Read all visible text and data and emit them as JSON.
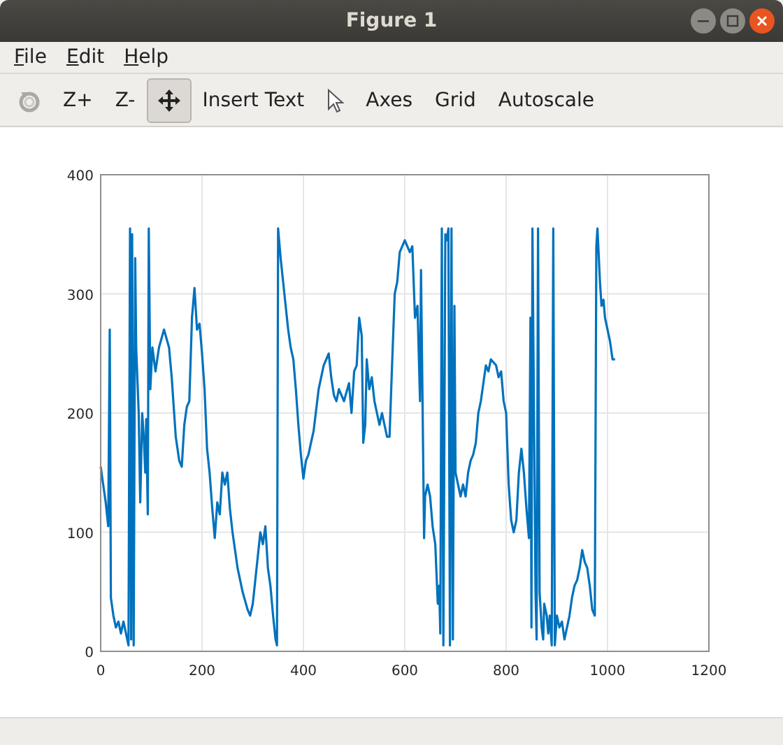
{
  "window": {
    "title": "Figure 1"
  },
  "menu": [
    {
      "label": "File"
    },
    {
      "label": "Edit"
    },
    {
      "label": "Help"
    }
  ],
  "toolbar": [
    {
      "kind": "rotate",
      "selected": false
    },
    {
      "kind": "text",
      "label": "Z+",
      "selected": false
    },
    {
      "kind": "text",
      "label": "Z-",
      "selected": false
    },
    {
      "kind": "pan",
      "selected": true
    },
    {
      "kind": "text",
      "label": "Insert Text",
      "selected": false
    },
    {
      "kind": "pointer",
      "selected": false
    },
    {
      "kind": "text",
      "label": "Axes",
      "selected": false
    },
    {
      "kind": "text",
      "label": "Grid",
      "selected": false
    },
    {
      "kind": "text",
      "label": "Autoscale",
      "selected": false
    }
  ],
  "plot": {
    "chart_data": {
      "type": "line",
      "grid": true,
      "xlim": [
        0,
        1200
      ],
      "ylim": [
        0,
        400
      ],
      "xticks": [
        0,
        200,
        400,
        600,
        800,
        1000,
        1200
      ],
      "yticks": [
        0,
        100,
        200,
        300,
        400
      ],
      "x": [
        0,
        5,
        10,
        15,
        18,
        20,
        25,
        30,
        35,
        40,
        45,
        50,
        55,
        58,
        60,
        62,
        65,
        68,
        70,
        75,
        78,
        82,
        85,
        88,
        90,
        93,
        95,
        98,
        102,
        108,
        115,
        125,
        135,
        140,
        148,
        155,
        160,
        165,
        170,
        175,
        180,
        185,
        190,
        195,
        200,
        205,
        210,
        215,
        220,
        225,
        230,
        235,
        240,
        245,
        250,
        255,
        260,
        265,
        270,
        280,
        290,
        295,
        300,
        305,
        310,
        315,
        320,
        325,
        330,
        335,
        340,
        345,
        348,
        350,
        355,
        360,
        365,
        370,
        375,
        380,
        385,
        390,
        395,
        400,
        405,
        410,
        415,
        420,
        430,
        440,
        450,
        455,
        460,
        465,
        470,
        475,
        480,
        490,
        495,
        500,
        505,
        510,
        515,
        518,
        522,
        525,
        530,
        535,
        540,
        545,
        550,
        555,
        560,
        565,
        570,
        575,
        580,
        585,
        590,
        595,
        600,
        605,
        610,
        615,
        620,
        625,
        630,
        632,
        635,
        638,
        640,
        645,
        650,
        655,
        660,
        665,
        668,
        670,
        673,
        676,
        680,
        683,
        686,
        689,
        692,
        695,
        698,
        700,
        705,
        710,
        715,
        720,
        725,
        730,
        735,
        740,
        745,
        750,
        755,
        760,
        765,
        770,
        780,
        785,
        790,
        795,
        800,
        805,
        810,
        815,
        820,
        825,
        830,
        835,
        840,
        845,
        848,
        850,
        852,
        855,
        858,
        860,
        863,
        866,
        870,
        873,
        875,
        880,
        883,
        886,
        890,
        893,
        896,
        900,
        905,
        910,
        915,
        920,
        925,
        930,
        935,
        940,
        945,
        950,
        955,
        960,
        965,
        970,
        975,
        978,
        980,
        985,
        988,
        992,
        995,
        1000,
        1005,
        1010,
        1015
      ],
      "series": [
        {
          "color": "#0072bd",
          "values": [
            155,
            140,
            125,
            105,
            270,
            45,
            30,
            20,
            25,
            15,
            25,
            15,
            5,
            355,
            10,
            350,
            5,
            330,
            255,
            200,
            125,
            200,
            180,
            150,
            195,
            115,
            355,
            220,
            255,
            235,
            255,
            270,
            255,
            230,
            180,
            160,
            155,
            190,
            205,
            210,
            280,
            305,
            270,
            275,
            250,
            220,
            170,
            150,
            120,
            95,
            125,
            115,
            150,
            140,
            150,
            120,
            100,
            85,
            70,
            50,
            35,
            30,
            40,
            60,
            80,
            100,
            90,
            105,
            70,
            55,
            30,
            10,
            5,
            355,
            330,
            310,
            290,
            270,
            255,
            245,
            220,
            190,
            165,
            145,
            160,
            165,
            175,
            185,
            220,
            240,
            250,
            230,
            215,
            210,
            220,
            215,
            210,
            225,
            200,
            235,
            240,
            280,
            265,
            175,
            190,
            245,
            220,
            230,
            210,
            200,
            190,
            200,
            190,
            180,
            180,
            240,
            300,
            310,
            335,
            340,
            345,
            340,
            335,
            340,
            280,
            290,
            210,
            320,
            210,
            95,
            130,
            140,
            130,
            105,
            90,
            40,
            55,
            15,
            355,
            5,
            350,
            345,
            355,
            5,
            355,
            10,
            290,
            150,
            140,
            130,
            140,
            130,
            150,
            160,
            165,
            175,
            200,
            210,
            225,
            240,
            235,
            245,
            240,
            230,
            235,
            210,
            200,
            140,
            110,
            100,
            110,
            150,
            170,
            150,
            120,
            95,
            280,
            20,
            355,
            200,
            50,
            10,
            355,
            50,
            20,
            10,
            40,
            30,
            15,
            30,
            5,
            355,
            5,
            30,
            20,
            25,
            10,
            20,
            30,
            45,
            55,
            60,
            70,
            85,
            75,
            70,
            55,
            35,
            30,
            340,
            355,
            310,
            290,
            295,
            280,
            270,
            260,
            245,
            245
          ]
        }
      ]
    }
  }
}
